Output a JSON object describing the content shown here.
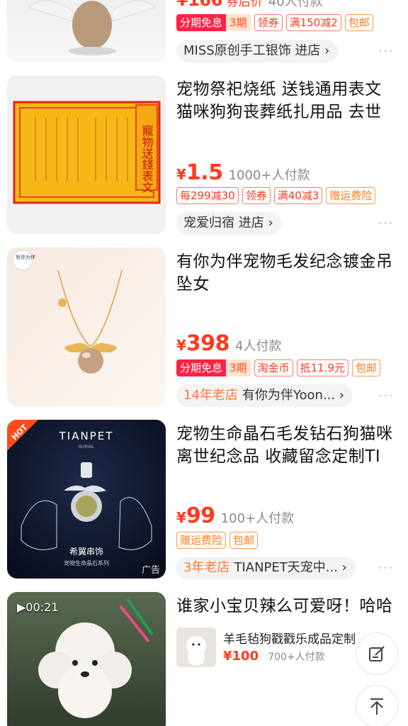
{
  "item0": {
    "price_partial": "¥166",
    "price_suffix": "券后价",
    "sales": "40人付款",
    "tags": {
      "fenqi_a": "分期免息",
      "fenqi_b": "3期",
      "coupon": "领券",
      "discount": "满150减2",
      "baoyou": "包邮"
    },
    "shop": "MISS原创手工银饰 进店",
    "more": "···"
  },
  "item1": {
    "title": "宠物祭祀烧纸 送钱通用表文 猫咪狗狗丧葬纸扎用品 去世",
    "image_caption": "寵物送錢表文",
    "price_currency": "¥",
    "price": "1.5",
    "sales": "1000+人付款",
    "tags": {
      "t1": "每299减30",
      "t2": "领券",
      "t3": "满40减3",
      "t4": "赠运费险"
    },
    "shop": "宠爱归宿 进店",
    "more": "···"
  },
  "item2": {
    "title": "有你为伴宠物毛发纪念镀金吊坠女",
    "image_badge": "有你为伴",
    "price_currency": "¥",
    "price": "398",
    "sales": "4人付款",
    "tags": {
      "fenqi_a": "分期免息",
      "fenqi_b": "3期",
      "t1": "淘金币",
      "t2": "抵11.9元",
      "t3": "包邮"
    },
    "shop_age": "14年老店",
    "shop": "有你为伴Yoon...",
    "more": "···"
  },
  "item3": {
    "title": "宠物生命晶石毛发钻石狗猫咪离世纪念品 收藏留念定制TI",
    "image_hot": "HOT",
    "image_brand": "TIANPET",
    "image_brand_sub": "BURIAL",
    "image_name": "希翼串饰",
    "image_name_sub": "宠物生命晶石系列",
    "ad_label": "广告",
    "price_currency": "¥",
    "price": "99",
    "sales": "100+人付款",
    "tags": {
      "t1": "赠运费险",
      "t2": "包邮"
    },
    "shop_age": "3年老店",
    "shop": "TIANPET天宠中...",
    "more": "···"
  },
  "item4": {
    "title": "谁家小宝贝辣么可爱呀！哈哈",
    "video_duration": "▶00:21",
    "related_title": "羊毛毡狗戳戳乐成品定制",
    "related_price": "¥100",
    "related_sales": "700+人付款"
  },
  "colors": {
    "accent": "#ff3a1f",
    "bg": "#ffffff",
    "gray": "#8a8a8a"
  },
  "icons": {
    "edit": "edit-icon",
    "top": "back-to-top-icon"
  }
}
